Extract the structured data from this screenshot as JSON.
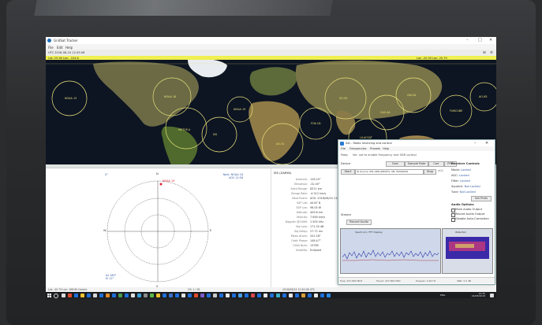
{
  "window": {
    "title": "GridSat Tracker",
    "controls": [
      "–",
      "□",
      "✕"
    ]
  },
  "menu": [
    "File",
    "Edit",
    "Help"
  ],
  "toolbar": {
    "text": "UTC 2018-08-24 12:45:08",
    "icons": [
      "grid-icon",
      "settings-icon"
    ]
  },
  "map_header": {
    "left": "Lat: 25.56  Lon: -104.6",
    "right": "Lat: -20.55  Lon: 25.70"
  },
  "map_labels": [
    "NOAA 15",
    "NOAA 18",
    "METOP-A",
    "ISS",
    "NOAA 19",
    "AO-91",
    "FOX-1D",
    "SO-50",
    "LILACSAT",
    "CAS-4A",
    "XW-2A",
    "FUNCUBE",
    "AO-85"
  ],
  "polar": {
    "north": "N",
    "south": "S",
    "east": "E",
    "west": "W",
    "sat_label": "NOAA 19",
    "top_left": "0°",
    "top_right": "Next: NOAA 18\nAOS 12:58",
    "bottom_left": "Az 180°\nEl 12°"
  },
  "info": {
    "title": "ISS (ZARYA)",
    "rows": [
      {
        "k": "Azimuth:",
        "v": "128.20°"
      },
      {
        "k": "Elevation:",
        "v": "-32.45°"
      },
      {
        "k": "Slant Range:",
        "v": "8311 km"
      },
      {
        "k": "Range Rate:",
        "v": "-4.512 km/s"
      },
      {
        "k": "Next Event:",
        "v": "AOS: 2018/08/24 13:12:06"
      },
      {
        "k": "SSP Lat:",
        "v": "44.87 N"
      },
      {
        "k": "SSP Lon:",
        "v": "98.05 W"
      },
      {
        "k": "Altitude:",
        "v": "409.8 km"
      },
      {
        "k": "Velocity:",
        "v": "7.658 km/s"
      },
      {
        "k": "Doppler @100M:",
        "v": "1.505 kHz"
      },
      {
        "k": "Sig Loss:",
        "v": "171.35 dB"
      },
      {
        "k": "Sig Delay:",
        "v": "27.72 ms"
      },
      {
        "k": "Mean Anom:",
        "v": "202.28°"
      },
      {
        "k": "Orbit Phase:",
        "v": "148.47°"
      },
      {
        "k": "Orbit Num:",
        "v": "13780"
      },
      {
        "k": "Visibility:",
        "v": "Eclipsed"
      }
    ]
  },
  "statusbar": {
    "left": "Lat: -40.79 Lon: 168.60 (lower)",
    "mid": "GS: 1 / 61",
    "right": "2018/08/24 12:45:08 UTC"
  },
  "taskbar": {
    "time": "12:45",
    "date": "24/08/2018",
    "lang": "ENG"
  },
  "dialog": {
    "title": "Sat - Radio receiving and control",
    "menu": [
      "File",
      "Frequencies",
      "Presets",
      "Help"
    ],
    "freq_label": "Freq:",
    "freq_hint": "Ver. set to enable frequency and SDR control",
    "device_label": "Device",
    "btn_start": "Start",
    "btn_list": "IQ Source: RTL-SDR (R820T), SN: 00000001",
    "btn_stop": "Stop",
    "gain_label": "AGC",
    "rx_labels": [
      "Gain",
      "Sample Rate",
      "Corr",
      "PPM"
    ],
    "controls_title": "Receiver Controls",
    "ctl_rows": [
      {
        "k": "Mode:",
        "v": "Locked"
      },
      {
        "k": "AGC:",
        "v": "Locked"
      },
      {
        "k": "Filter:",
        "v": "Locked"
      },
      {
        "k": "Squelch:",
        "v": "Not Locked"
      },
      {
        "k": "Tune:",
        "v": "Not Locked"
      }
    ],
    "apply": "Set Prefs",
    "audio_title": "Audio Options",
    "audio_opts": [
      "Mute Audio Output",
      "Record Audio Output",
      "Disable Auto-Correction"
    ],
    "stream_label": "Stream",
    "stream_btn": "Record Audio",
    "spectrum_title": "Spectrum / FFT Display",
    "waterfall_title": "Waterfall",
    "status": [
      "Freq: 437.800 MHz",
      "Tuned: 437.800 MHz",
      "Doppler: 0.00 Hz",
      "SNR: 3.2 dB"
    ]
  }
}
